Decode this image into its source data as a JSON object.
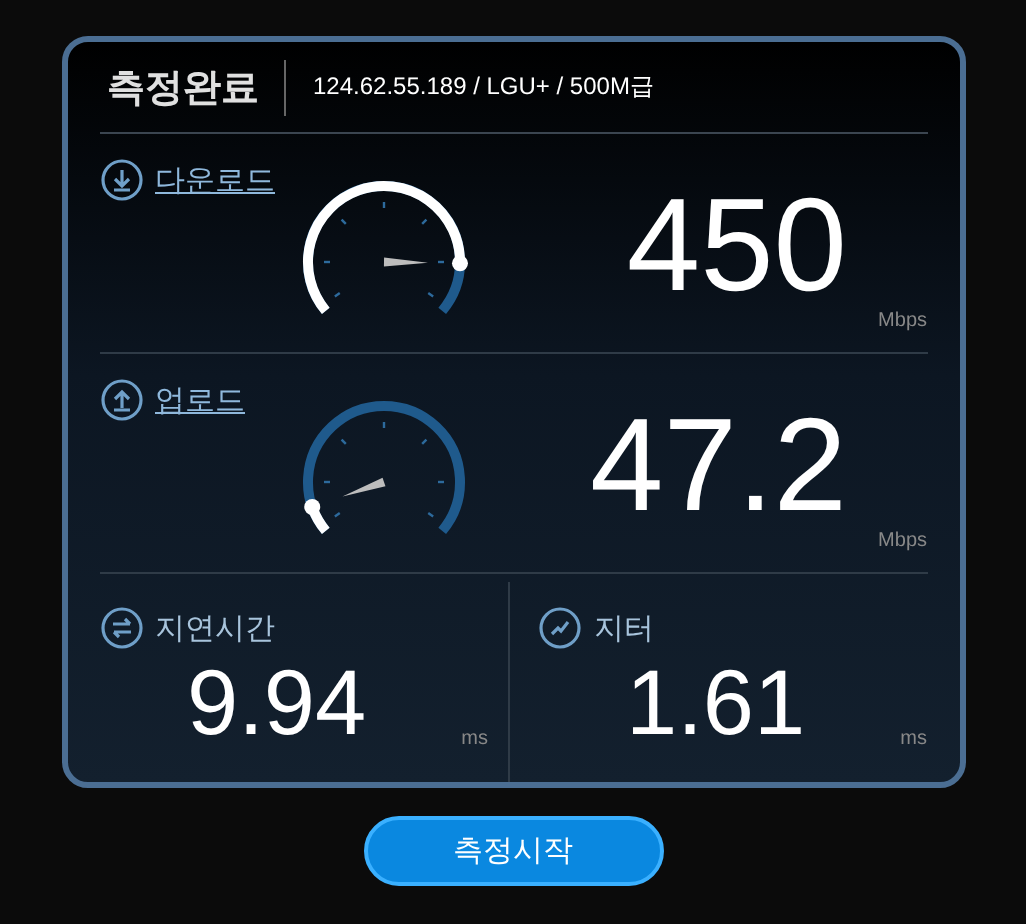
{
  "header": {
    "title": "측정완료",
    "info": "124.62.55.189 / LGU+ / 500M급"
  },
  "speeds": [
    {
      "kind": "download",
      "label": "다운로드",
      "value": "450",
      "unit": "Mbps"
    },
    {
      "kind": "upload",
      "label": "업로드",
      "value": "47.2",
      "unit": "Mbps"
    }
  ],
  "stats": [
    {
      "kind": "latency",
      "label": "지연시간",
      "value": "9.94",
      "unit": "ms"
    },
    {
      "kind": "jitter",
      "label": "지터",
      "value": "1.61",
      "unit": "ms"
    }
  ],
  "button": "측정시작"
}
